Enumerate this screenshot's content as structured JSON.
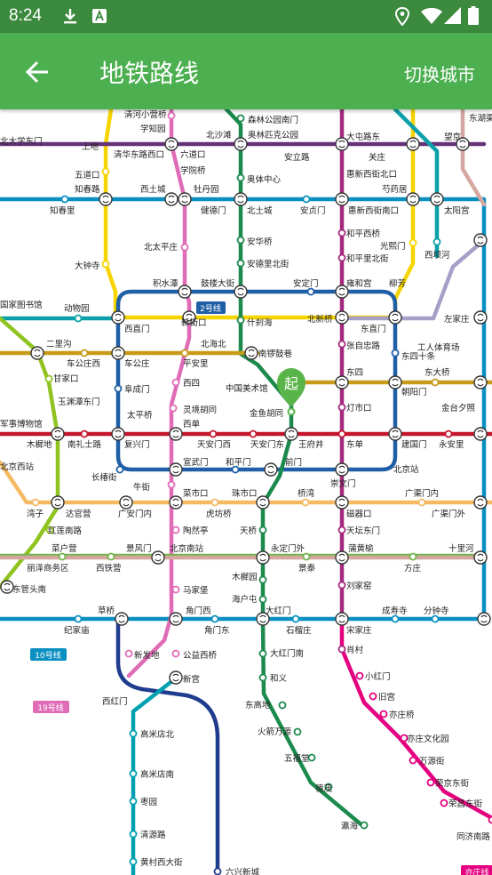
{
  "status_bar": {
    "time": "8:24",
    "icons": [
      "download-icon",
      "a-notification-icon",
      "location-icon",
      "wifi-icon",
      "signal-icon",
      "battery-icon"
    ]
  },
  "app_bar": {
    "title": "地铁路线",
    "back_icon": "arrow-left-icon",
    "switch_city_label": "切换城市"
  },
  "colors": {
    "status_bar": "#3b8a3e",
    "app_bar": "#4caf50",
    "line1": "#c5152d",
    "line2": "#1f5fa6",
    "line4": "#0ba0a9",
    "line5": "#a52a7f",
    "line6": "#c79b1a",
    "line7": "#f5b963",
    "line8": "#1c8a4d",
    "line9": "#8fc31f",
    "line10": "#0a8fc1",
    "line13": "#f6d400",
    "line14": "#d5a7a0",
    "line16": "#74b44c",
    "line19": "#e06cb8",
    "yizhuang": "#e4007f",
    "start_marker": "#59b54a"
  },
  "map": {
    "start_marker_label": "起",
    "line_badges": [
      "2号线",
      "10号线",
      "19号线",
      "亦庄线"
    ],
    "stations": [
      "清河小营桥",
      "森林公园南门",
      "东湖渠",
      "北大学东门",
      "学知园",
      "北沙滩",
      "奥林匹克公园",
      "大屯路东",
      "安立路",
      "望京",
      "关庄",
      "上地",
      "清华东路西口",
      "六道口",
      "五道口",
      "芍药居",
      "知春路",
      "西土城",
      "牡丹园",
      "健德门",
      "北土城",
      "安贞门",
      "惠新西街南口",
      "太阳宫",
      "知春里",
      "学院桥",
      "奥体中心",
      "惠新西街北口",
      "光熙门",
      "西坝河",
      "北太平庄",
      "安华桥",
      "安德里北街",
      "和平西桥",
      "和平里北街",
      "柳芳",
      "大钟寺",
      "积水潭",
      "鼓楼大街",
      "安定门",
      "雍和宫",
      "国家图书馆",
      "动物园",
      "西直门",
      "新街口",
      "什刹海",
      "北新桥",
      "东直门",
      "左家庄",
      "二里沟",
      "北海北",
      "南锣鼓巷",
      "张自忠路",
      "工人体育场",
      "东四十条",
      "车公庄西",
      "车公庄",
      "平安里",
      "东四",
      "东大桥",
      "甘家口",
      "中国美术馆",
      "朝阳门",
      "玉渊潭东门",
      "阜成门",
      "西四",
      "灯市口",
      "金台夕照",
      "太平桥",
      "灵境胡同",
      "金鱼胡同",
      "军事博物馆",
      "木樨地",
      "南礼士路",
      "复兴门",
      "西单",
      "天安门西",
      "天安门东",
      "王府井",
      "东单",
      "建国门",
      "永安里",
      "北京西站",
      "宣武门",
      "和平门",
      "前门",
      "北京站",
      "长椿街",
      "牛街",
      "崇文门",
      "菜市口",
      "珠市口",
      "桥湾",
      "磁器口",
      "广渠门内",
      "湾子",
      "达官营",
      "广安门内",
      "虎坊桥",
      "广渠门外",
      "红莲南路",
      "陶然亭",
      "天桥",
      "天坛东门",
      "菜户营",
      "景风门",
      "北京南站",
      "永定门外",
      "蒲黄榆",
      "十里河",
      "丽泽商务区",
      "西铁营",
      "景泰",
      "方庄",
      "东管头南",
      "马家堡",
      "木樨园",
      "刘家窑",
      "草桥",
      "角门西",
      "海户屯",
      "大红门",
      "成寿寺",
      "分钟寺",
      "纪家庙",
      "角门东",
      "石榴庄",
      "宋家庄",
      "新发地",
      "公益西桥",
      "大红门南",
      "肖村",
      "新宫",
      "和义",
      "小红门",
      "西红门",
      "东高地",
      "旧宫",
      "亦庄桥",
      "高米店北",
      "火箭万源",
      "亦庄文化园",
      "五福堂",
      "万源街",
      "高米店南",
      "德茂",
      "荣京东街",
      "枣园",
      "瀛海",
      "荣昌东街",
      "清源路",
      "同济南路",
      "黄村西大街",
      "六兴新城"
    ]
  }
}
